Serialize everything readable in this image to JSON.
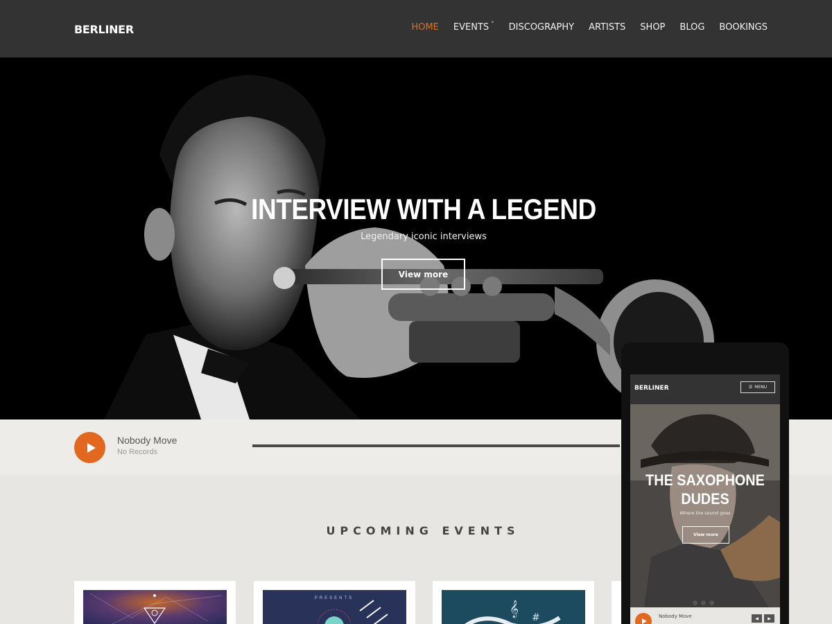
{
  "header": {
    "logo": "BERLINER",
    "nav": [
      {
        "label": "HOME",
        "active": true
      },
      {
        "label": "EVENTS",
        "has_dropdown": true
      },
      {
        "label": "DISCOGRAPHY"
      },
      {
        "label": "ARTISTS"
      },
      {
        "label": "SHOP"
      },
      {
        "label": "BLOG"
      },
      {
        "label": "BOOKINGS"
      }
    ]
  },
  "hero": {
    "title": "INTERVIEW WITH A LEGEND",
    "subtitle": "Legendary iconic interviews",
    "button": "View more"
  },
  "player": {
    "track_title": "Nobody Move",
    "track_subtitle": "No Records",
    "play_icon": "play-icon"
  },
  "events": {
    "title": "UPCOMING EVENTS",
    "cards": [
      {
        "art": "geometric-cosmos"
      },
      {
        "art": "presents-poster",
        "text": "PRESENTS"
      },
      {
        "art": "music-notes"
      },
      {
        "art": "partial"
      }
    ]
  },
  "mobile": {
    "logo": "BERLINER",
    "menu_label": "MENU",
    "hero_title_line1": "THE SAXOPHONE",
    "hero_title_line2": "DUDES",
    "hero_subtitle": "Where the sound goes",
    "hero_button": "View more",
    "track_title": "Nobody Move"
  },
  "colors": {
    "accent": "#e2671f",
    "header_bg": "#333333",
    "page_bg": "#ebe9e5"
  }
}
